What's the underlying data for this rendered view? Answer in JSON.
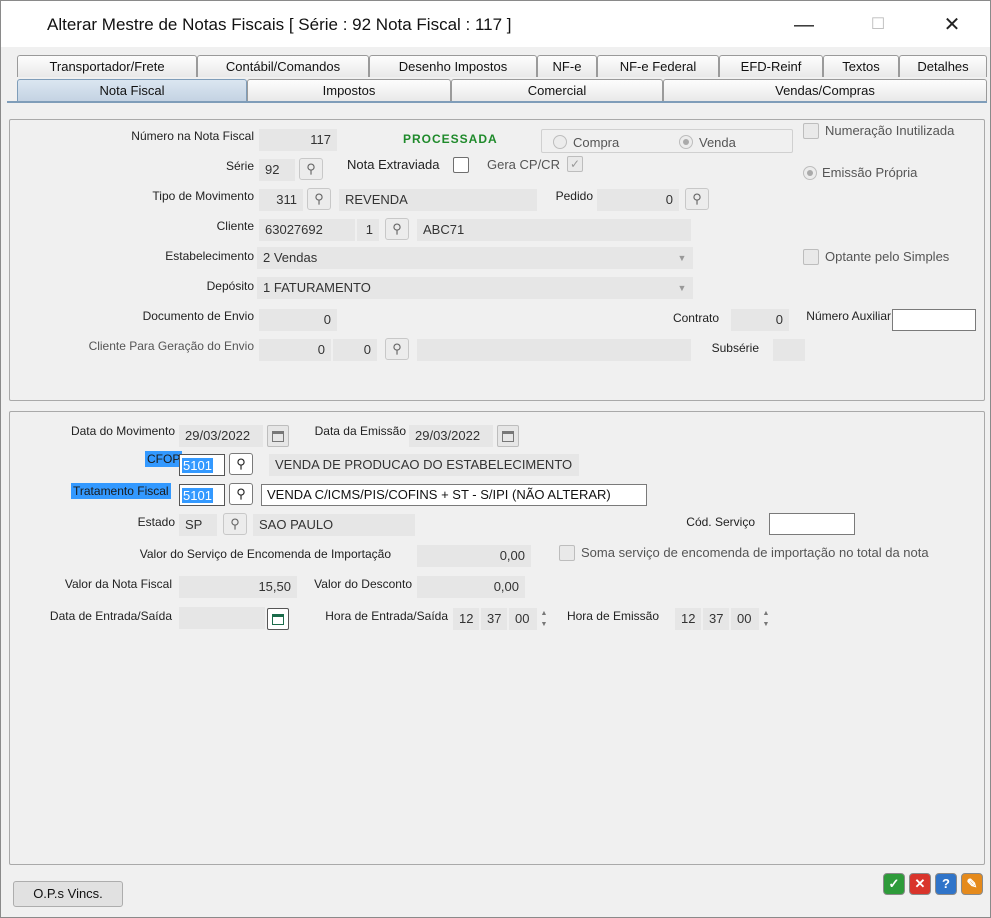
{
  "window": {
    "title": "Alterar Mestre de Notas Fiscais [ Série : 92  Nota Fiscal : 117 ]",
    "minimize": "—",
    "maximize": "☐",
    "close": "✕"
  },
  "tabs_row1": [
    "Transportador/Frete",
    "Contábil/Comandos",
    "Desenho Impostos",
    "NF-e",
    "NF-e Federal",
    "EFD-Reinf",
    "Textos",
    "Detalhes"
  ],
  "tabs_row2": [
    "Nota Fiscal",
    "Impostos",
    "Comercial",
    "Vendas/Compras"
  ],
  "top": {
    "numero_label": "Número na Nota Fiscal",
    "numero_value": "117",
    "status": "PROCESSADA",
    "compra_label": "Compra",
    "venda_label": "Venda",
    "numeracao_label": "Numeração Inutilizada",
    "serie_label": "Série",
    "serie_value": "92",
    "nota_extraviada_label": "Nota Extraviada",
    "gera_label": "Gera CP/CR",
    "emissao_label": "Emissão Própria",
    "tipo_label": "Tipo de Movimento",
    "tipo_code": "311",
    "tipo_desc": "REVENDA",
    "pedido_label": "Pedido",
    "pedido_value": "0",
    "cliente_label": "Cliente",
    "cliente_code": "63027692",
    "cliente_seq": "1",
    "cliente_nome": "ABC71",
    "estab_label": "Estabelecimento",
    "estab_value": "2 Vendas",
    "optante_label": "Optante pelo Simples",
    "deposito_label": "Depósito",
    "deposito_value": "1 FATURAMENTO",
    "doc_envio_label": "Documento de Envio",
    "doc_envio_value": "0",
    "contrato_label": "Contrato",
    "contrato_value": "0",
    "num_aux_label": "Número Auxiliar",
    "num_aux_value": "",
    "cli_envio_label": "Cliente Para Geração do Envio",
    "cli_envio_a": "0",
    "cli_envio_b": "0",
    "cli_envio_nome": "",
    "subserie_label": "Subsérie",
    "subserie_value": ""
  },
  "bottom": {
    "data_mov_label": "Data do Movimento",
    "data_mov_value": "29/03/2022",
    "data_emis_label": "Data da Emissão",
    "data_emis_value": "29/03/2022",
    "cfop_label": "CFOP",
    "cfop_value": "5101",
    "cfop_desc": "VENDA DE PRODUCAO DO ESTABELECIMENTO",
    "trat_label": "Tratamento Fiscal",
    "trat_value": "5101",
    "trat_desc": "VENDA C/ICMS/PIS/COFINS + ST - S/IPI (NÃO ALTERAR)",
    "estado_label": "Estado",
    "estado_value": "SP",
    "estado_nome": "SAO PAULO",
    "cod_serv_label": "Cód. Serviço",
    "cod_serv_value": "",
    "valor_serv_label": "Valor do Serviço de Encomenda de Importação",
    "valor_serv_value": "0,00",
    "soma_label": "Soma serviço de encomenda de importação no total da nota",
    "valor_nf_label": "Valor da Nota Fiscal",
    "valor_nf_value": "15,50",
    "valor_desc_label": "Valor do Desconto",
    "valor_desc_value": "0,00",
    "data_es_label": "Data de Entrada/Saída",
    "data_es_value": "",
    "hora_es_label": "Hora de Entrada/Saída",
    "hora_es_h": "12",
    "hora_es_m": "37",
    "hora_es_s": "00",
    "hora_emis_label": "Hora de Emissão",
    "hora_emis_h": "12",
    "hora_emis_m": "37",
    "hora_emis_s": "00"
  },
  "footer": {
    "ops_button": "O.P.s Vincs.",
    "ok_icon": "check-icon",
    "cancel_icon": "cancel-icon",
    "help_icon": "help-icon",
    "tool_icon": "wrench-icon",
    "colors": {
      "ok": "#2e9b3a",
      "cancel": "#d9342b",
      "help": "#2f74c9",
      "tool": "#e58a1c"
    }
  }
}
